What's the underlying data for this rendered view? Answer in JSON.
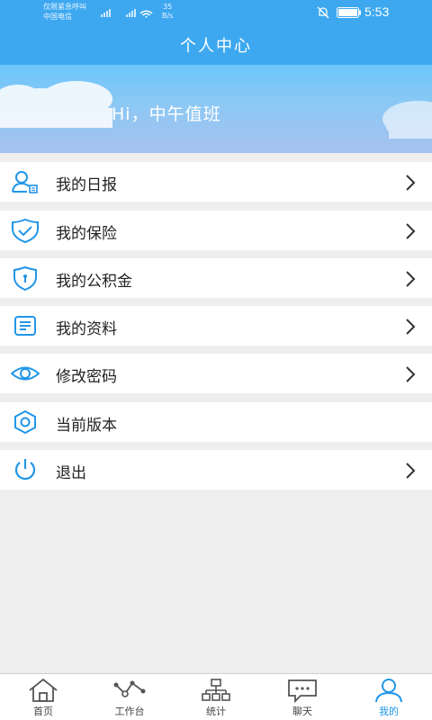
{
  "status_bar": {
    "carrier_line1": "仅限紧急呼叫",
    "carrier_line2": "中国电信",
    "net_speed_value": "35",
    "net_speed_unit": "B/s",
    "time": "5:53"
  },
  "header": {
    "title": "个人中心"
  },
  "profile": {
    "greeting": "Hi，中午值班"
  },
  "menu": {
    "items": [
      {
        "label": "我的日报",
        "icon": "user-report-icon"
      },
      {
        "label": "我的保险",
        "icon": "shield-check-icon"
      },
      {
        "label": "我的公积金",
        "icon": "shield-lock-icon"
      },
      {
        "label": "我的资料",
        "icon": "document-icon"
      },
      {
        "label": "修改密码",
        "icon": "eye-icon"
      },
      {
        "label": "当前版本",
        "icon": "hexagon-icon"
      },
      {
        "label": "退出",
        "icon": "power-icon"
      }
    ]
  },
  "tabbar": {
    "tabs": [
      {
        "label": "首页",
        "icon": "home-icon"
      },
      {
        "label": "工作台",
        "icon": "workbench-icon"
      },
      {
        "label": "统计",
        "icon": "org-chart-icon"
      },
      {
        "label": "聊天",
        "icon": "chat-icon"
      },
      {
        "label": "我的",
        "icon": "profile-icon"
      }
    ],
    "active_index": 4
  },
  "colors": {
    "primary": "#3da8f0",
    "icon_blue": "#2196e8",
    "background": "#eeeeee"
  }
}
